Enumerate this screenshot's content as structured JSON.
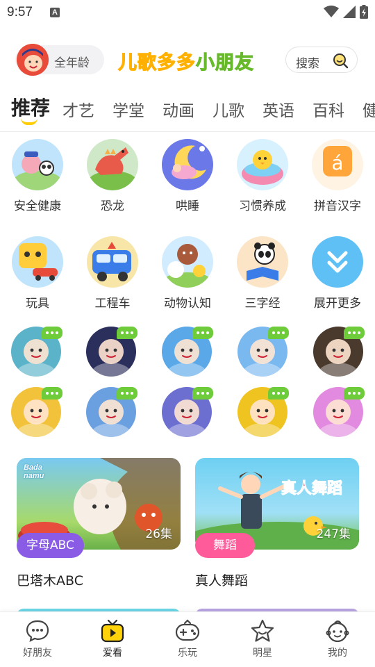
{
  "status_bar": {
    "time": "9:57",
    "notif_letter": "A"
  },
  "header": {
    "age_label": "全年龄",
    "brand_part1": "儿歌多多",
    "brand_part2": "小朋友",
    "search_label": "搜索"
  },
  "tabs": [
    "推荐",
    "才艺",
    "学堂",
    "动画",
    "儿歌",
    "英语",
    "百科",
    "健"
  ],
  "categories": [
    {
      "label": "安全健康",
      "icon": "safety-icon"
    },
    {
      "label": "恐龙",
      "icon": "dinosaur-icon"
    },
    {
      "label": "哄睡",
      "icon": "sleep-icon"
    },
    {
      "label": "习惯养成",
      "icon": "habit-icon"
    },
    {
      "label": "拼音汉字",
      "icon": "pinyin-icon",
      "glyph": "á"
    },
    {
      "label": "玩具",
      "icon": "toy-icon"
    },
    {
      "label": "工程车",
      "icon": "truck-icon"
    },
    {
      "label": "动物认知",
      "icon": "animal-icon"
    },
    {
      "label": "三字经",
      "icon": "classic-book-icon"
    },
    {
      "label": "展开更多",
      "icon": "expand-more-icon"
    }
  ],
  "characters": [
    {
      "name": "nezha-avatar",
      "color": "#5ab3c8"
    },
    {
      "name": "ultraman-avatar",
      "color": "#2b2f5c"
    },
    {
      "name": "peppa-avatar",
      "color": "#5aa8e8"
    },
    {
      "name": "elsa-avatar",
      "color": "#7ab8f0"
    },
    {
      "name": "princess-avatar",
      "color": "#4a3a2e"
    },
    {
      "name": "paw-patrol-avatar",
      "color": "#f2c33a"
    },
    {
      "name": "boonie-bear-avatar",
      "color": "#6aa0e0"
    },
    {
      "name": "ultraman-tiga-avatar",
      "color": "#6c6fd0"
    },
    {
      "name": "pony-avatar",
      "color": "#f0c420"
    },
    {
      "name": "pink-doll-avatar",
      "color": "#e28adf"
    }
  ],
  "cards": [
    {
      "title": "巴塔木ABC",
      "count": "26集",
      "tag": "字母ABC",
      "tag_color": "#8a5ce6",
      "logo": "Bada namu"
    },
    {
      "title": "真人舞蹈",
      "count": "247集",
      "tag": "舞蹈",
      "tag_color": "#ff5b9a",
      "banner": "真人舞蹈"
    }
  ],
  "nav": [
    {
      "label": "好朋友",
      "icon": "chat-bubble-icon"
    },
    {
      "label": "爱看",
      "icon": "tv-icon",
      "active": true
    },
    {
      "label": "乐玩",
      "icon": "gamepad-icon"
    },
    {
      "label": "明星",
      "icon": "star-icon"
    },
    {
      "label": "我的",
      "icon": "baby-face-icon"
    }
  ]
}
